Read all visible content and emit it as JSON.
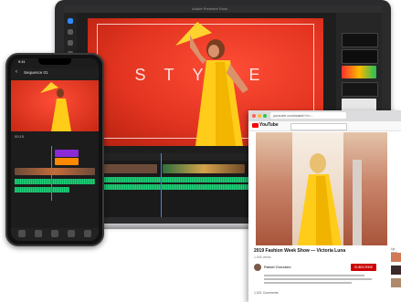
{
  "laptop": {
    "app_title": "Adobe Premiere Rush",
    "preview_text": "STYLE"
  },
  "phone": {
    "status_time": "9:41",
    "sequence_title": "Sequence 01",
    "timecode": "00:15"
  },
  "browser": {
    "url": "youtube.com/watch?v=...",
    "logo_label": "YouTube",
    "video_title": "2019 Fashion Week Show — Victoria Luna",
    "video_meta": "1,000 views",
    "channel_name": "Rafael Gonzalez",
    "subscribe_label": "SUBSCRIBE",
    "comments_label": "1,021 Comments",
    "upnext_label": "Up next"
  },
  "colors": {
    "accent_blue": "#2f8cff",
    "brand_red": "#ff0000",
    "audio_green": "#1ed47a",
    "clip_purple": "#8a2bd6",
    "clip_orange": "#ff8a00"
  }
}
